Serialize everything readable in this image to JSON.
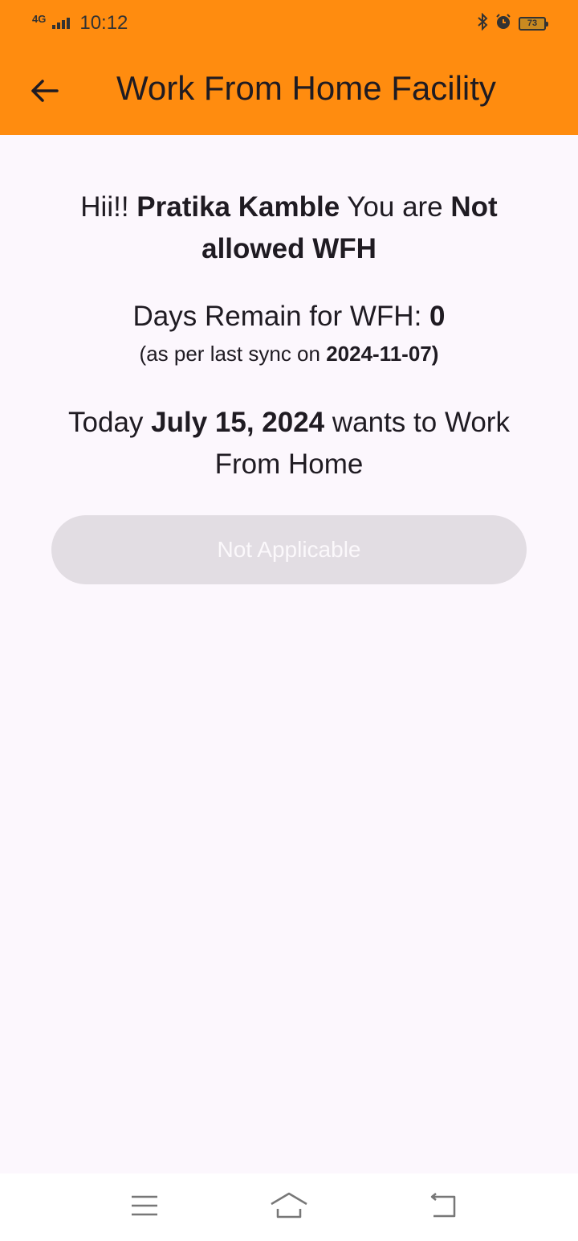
{
  "status_bar": {
    "network": "4G",
    "time": "10:12",
    "battery": "73"
  },
  "app_bar": {
    "title": "Work From Home Facility"
  },
  "greeting": {
    "prefix": "Hii!! ",
    "name": "Pratika Kamble",
    "middle": " You are ",
    "status": "Not allowed WFH"
  },
  "days_remain": {
    "label": "Days Remain for WFH: ",
    "value": "0",
    "sync_prefix": "(as per last sync on ",
    "sync_date": "2024-11-07",
    "sync_suffix": ")"
  },
  "today": {
    "prefix": "Today ",
    "date": "July 15, 2024",
    "suffix": " wants to Work From Home"
  },
  "action_button": {
    "label": "Not Applicable"
  },
  "colors": {
    "app_bar": "#ff8c0f",
    "background": "#fcf7fd",
    "button_disabled": "#e2dde3"
  }
}
